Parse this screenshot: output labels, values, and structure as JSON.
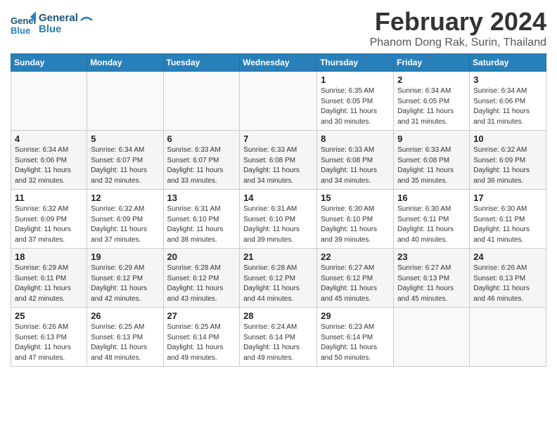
{
  "header": {
    "logo_line1": "General",
    "logo_line2": "Blue",
    "month_year": "February 2024",
    "location": "Phanom Dong Rak, Surin, Thailand"
  },
  "days_of_week": [
    "Sunday",
    "Monday",
    "Tuesday",
    "Wednesday",
    "Thursday",
    "Friday",
    "Saturday"
  ],
  "weeks": [
    [
      {
        "day": "",
        "info": ""
      },
      {
        "day": "",
        "info": ""
      },
      {
        "day": "",
        "info": ""
      },
      {
        "day": "",
        "info": ""
      },
      {
        "day": "1",
        "info": "Sunrise: 6:35 AM\nSunset: 6:05 PM\nDaylight: 11 hours\nand 30 minutes."
      },
      {
        "day": "2",
        "info": "Sunrise: 6:34 AM\nSunset: 6:05 PM\nDaylight: 11 hours\nand 31 minutes."
      },
      {
        "day": "3",
        "info": "Sunrise: 6:34 AM\nSunset: 6:06 PM\nDaylight: 11 hours\nand 31 minutes."
      }
    ],
    [
      {
        "day": "4",
        "info": "Sunrise: 6:34 AM\nSunset: 6:06 PM\nDaylight: 11 hours\nand 32 minutes."
      },
      {
        "day": "5",
        "info": "Sunrise: 6:34 AM\nSunset: 6:07 PM\nDaylight: 11 hours\nand 32 minutes."
      },
      {
        "day": "6",
        "info": "Sunrise: 6:33 AM\nSunset: 6:07 PM\nDaylight: 11 hours\nand 33 minutes."
      },
      {
        "day": "7",
        "info": "Sunrise: 6:33 AM\nSunset: 6:08 PM\nDaylight: 11 hours\nand 34 minutes."
      },
      {
        "day": "8",
        "info": "Sunrise: 6:33 AM\nSunset: 6:08 PM\nDaylight: 11 hours\nand 34 minutes."
      },
      {
        "day": "9",
        "info": "Sunrise: 6:33 AM\nSunset: 6:08 PM\nDaylight: 11 hours\nand 35 minutes."
      },
      {
        "day": "10",
        "info": "Sunrise: 6:32 AM\nSunset: 6:09 PM\nDaylight: 11 hours\nand 36 minutes."
      }
    ],
    [
      {
        "day": "11",
        "info": "Sunrise: 6:32 AM\nSunset: 6:09 PM\nDaylight: 11 hours\nand 37 minutes."
      },
      {
        "day": "12",
        "info": "Sunrise: 6:32 AM\nSunset: 6:09 PM\nDaylight: 11 hours\nand 37 minutes."
      },
      {
        "day": "13",
        "info": "Sunrise: 6:31 AM\nSunset: 6:10 PM\nDaylight: 11 hours\nand 38 minutes."
      },
      {
        "day": "14",
        "info": "Sunrise: 6:31 AM\nSunset: 6:10 PM\nDaylight: 11 hours\nand 39 minutes."
      },
      {
        "day": "15",
        "info": "Sunrise: 6:30 AM\nSunset: 6:10 PM\nDaylight: 11 hours\nand 39 minutes."
      },
      {
        "day": "16",
        "info": "Sunrise: 6:30 AM\nSunset: 6:11 PM\nDaylight: 11 hours\nand 40 minutes."
      },
      {
        "day": "17",
        "info": "Sunrise: 6:30 AM\nSunset: 6:11 PM\nDaylight: 11 hours\nand 41 minutes."
      }
    ],
    [
      {
        "day": "18",
        "info": "Sunrise: 6:29 AM\nSunset: 6:11 PM\nDaylight: 11 hours\nand 42 minutes."
      },
      {
        "day": "19",
        "info": "Sunrise: 6:29 AM\nSunset: 6:12 PM\nDaylight: 11 hours\nand 42 minutes."
      },
      {
        "day": "20",
        "info": "Sunrise: 6:28 AM\nSunset: 6:12 PM\nDaylight: 11 hours\nand 43 minutes."
      },
      {
        "day": "21",
        "info": "Sunrise: 6:28 AM\nSunset: 6:12 PM\nDaylight: 11 hours\nand 44 minutes."
      },
      {
        "day": "22",
        "info": "Sunrise: 6:27 AM\nSunset: 6:12 PM\nDaylight: 11 hours\nand 45 minutes."
      },
      {
        "day": "23",
        "info": "Sunrise: 6:27 AM\nSunset: 6:13 PM\nDaylight: 11 hours\nand 45 minutes."
      },
      {
        "day": "24",
        "info": "Sunrise: 6:26 AM\nSunset: 6:13 PM\nDaylight: 11 hours\nand 46 minutes."
      }
    ],
    [
      {
        "day": "25",
        "info": "Sunrise: 6:26 AM\nSunset: 6:13 PM\nDaylight: 11 hours\nand 47 minutes."
      },
      {
        "day": "26",
        "info": "Sunrise: 6:25 AM\nSunset: 6:13 PM\nDaylight: 11 hours\nand 48 minutes."
      },
      {
        "day": "27",
        "info": "Sunrise: 6:25 AM\nSunset: 6:14 PM\nDaylight: 11 hours\nand 49 minutes."
      },
      {
        "day": "28",
        "info": "Sunrise: 6:24 AM\nSunset: 6:14 PM\nDaylight: 11 hours\nand 49 minutes."
      },
      {
        "day": "29",
        "info": "Sunrise: 6:23 AM\nSunset: 6:14 PM\nDaylight: 11 hours\nand 50 minutes."
      },
      {
        "day": "",
        "info": ""
      },
      {
        "day": "",
        "info": ""
      }
    ]
  ]
}
